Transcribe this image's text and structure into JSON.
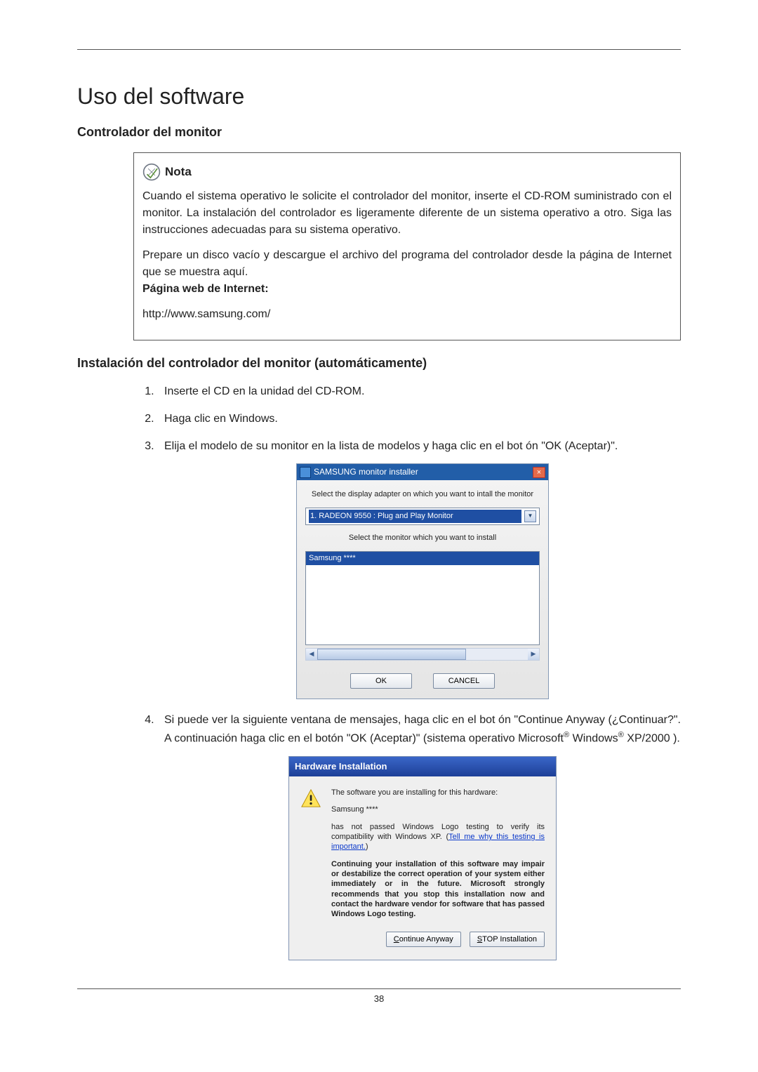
{
  "page": {
    "title": "Uso del software",
    "h2_1": "Controlador del monitor",
    "h2_2": "Instalación del controlador del monitor (automáticamente)",
    "pageno": "38"
  },
  "nota": {
    "label": "Nota",
    "p1": "Cuando el sistema operativo le solicite el controlador del monitor, inserte el CD-ROM suministrado con el monitor. La instalación del controlador es ligeramente diferente de un sistema operativo a otro. Siga las instrucciones adecuadas para su sistema operativo.",
    "p2": "Prepare un disco vacío y descargue el archivo del programa del controlador desde la página de Internet que se muestra aquí.",
    "label_web": "Página web de Internet:",
    "url": "http://www.samsung.com/"
  },
  "steps": {
    "s1": "Inserte el CD en la unidad del CD-ROM.",
    "s2": "Haga clic en Windows.",
    "s3": "Elija el modelo de su monitor en la lista de modelos y haga clic en el bot ón \"OK (Aceptar)\".",
    "s4_a": "Si puede ver la siguiente ventana de mensajes, haga clic en el bot ón \"Continue Anyway (¿Continuar?\". A continuación haga clic en el botón \"OK (Aceptar)\" (sistema operativo Microsoft",
    "s4_b": " Windows",
    "s4_c": " XP/2000 )."
  },
  "dlg1": {
    "title": "SAMSUNG monitor installer",
    "hint1": "Select the display adapter on which you want to intall the monitor",
    "adapter": "1. RADEON 9550 : Plug and Play Monitor",
    "hint2": "Select the monitor which you want to install",
    "listitem": "Samsung ****",
    "ok": "OK",
    "cancel": "CANCEL",
    "close": "×"
  },
  "dlg2": {
    "title": "Hardware Installation",
    "p1": "The software you are installing for this hardware:",
    "p2": "Samsung ****",
    "p3a": "has not passed Windows Logo testing to verify its compatibility with Windows XP. (",
    "link": "Tell me why this testing is important.",
    "p3b": ")",
    "p4": "Continuing your installation of this software may impair or destabilize the correct operation of your system either immediately or in the future. Microsoft strongly recommends that you stop this installation now and contact the hardware vendor for software that has passed Windows Logo testing.",
    "btn_continue_u": "C",
    "btn_continue_rest": "ontinue Anyway",
    "btn_stop_u": "S",
    "btn_stop_rest": "TOP Installation"
  }
}
